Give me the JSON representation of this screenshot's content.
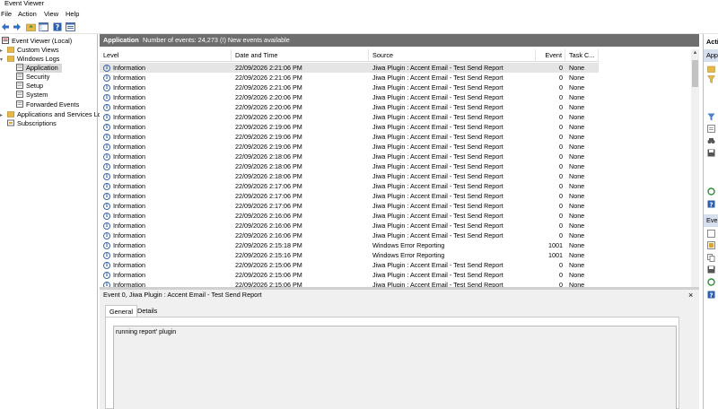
{
  "window": {
    "title": "Event Viewer"
  },
  "menu": [
    "File",
    "Action",
    "View",
    "Help"
  ],
  "tree": {
    "root": "Event Viewer (Local)",
    "custom_views": "Custom Views",
    "windows_logs": "Windows Logs",
    "logs": [
      "Application",
      "Security",
      "Setup",
      "System",
      "Forwarded Events"
    ],
    "apps_services": "Applications and Services Lo",
    "subscriptions": "Subscriptions"
  },
  "header": {
    "log_name": "Application",
    "count_text": "Number of events: 24,273 (!) New events available"
  },
  "columns": [
    "Level",
    "Date and Time",
    "Source",
    "Event ID",
    "Task C..."
  ],
  "rows": [
    {
      "level": "Information",
      "date": "22/09/2026 2:21:06 PM",
      "source": "Jiwa Plugin : Accent Email - Test Send Report",
      "id": "0",
      "task": "None"
    },
    {
      "level": "Information",
      "date": "22/09/2026 2:21:06 PM",
      "source": "Jiwa Plugin : Accent Email - Test Send Report",
      "id": "0",
      "task": "None"
    },
    {
      "level": "Information",
      "date": "22/09/2026 2:21:06 PM",
      "source": "Jiwa Plugin : Accent Email - Test Send Report",
      "id": "0",
      "task": "None"
    },
    {
      "level": "Information",
      "date": "22/09/2026 2:20:06 PM",
      "source": "Jiwa Plugin : Accent Email - Test Send Report",
      "id": "0",
      "task": "None"
    },
    {
      "level": "Information",
      "date": "22/09/2026 2:20:06 PM",
      "source": "Jiwa Plugin : Accent Email - Test Send Report",
      "id": "0",
      "task": "None"
    },
    {
      "level": "Information",
      "date": "22/09/2026 2:20:06 PM",
      "source": "Jiwa Plugin : Accent Email - Test Send Report",
      "id": "0",
      "task": "None"
    },
    {
      "level": "Information",
      "date": "22/09/2026 2:19:06 PM",
      "source": "Jiwa Plugin : Accent Email - Test Send Report",
      "id": "0",
      "task": "None"
    },
    {
      "level": "Information",
      "date": "22/09/2026 2:19:06 PM",
      "source": "Jiwa Plugin : Accent Email - Test Send Report",
      "id": "0",
      "task": "None"
    },
    {
      "level": "Information",
      "date": "22/09/2026 2:19:06 PM",
      "source": "Jiwa Plugin : Accent Email - Test Send Report",
      "id": "0",
      "task": "None"
    },
    {
      "level": "Information",
      "date": "22/09/2026 2:18:06 PM",
      "source": "Jiwa Plugin : Accent Email - Test Send Report",
      "id": "0",
      "task": "None"
    },
    {
      "level": "Information",
      "date": "22/09/2026 2:18:06 PM",
      "source": "Jiwa Plugin : Accent Email - Test Send Report",
      "id": "0",
      "task": "None"
    },
    {
      "level": "Information",
      "date": "22/09/2026 2:18:06 PM",
      "source": "Jiwa Plugin : Accent Email - Test Send Report",
      "id": "0",
      "task": "None"
    },
    {
      "level": "Information",
      "date": "22/09/2026 2:17:06 PM",
      "source": "Jiwa Plugin : Accent Email - Test Send Report",
      "id": "0",
      "task": "None"
    },
    {
      "level": "Information",
      "date": "22/09/2026 2:17:06 PM",
      "source": "Jiwa Plugin : Accent Email - Test Send Report",
      "id": "0",
      "task": "None"
    },
    {
      "level": "Information",
      "date": "22/09/2026 2:17:06 PM",
      "source": "Jiwa Plugin : Accent Email - Test Send Report",
      "id": "0",
      "task": "None"
    },
    {
      "level": "Information",
      "date": "22/09/2026 2:16:06 PM",
      "source": "Jiwa Plugin : Accent Email - Test Send Report",
      "id": "0",
      "task": "None"
    },
    {
      "level": "Information",
      "date": "22/09/2026 2:16:06 PM",
      "source": "Jiwa Plugin : Accent Email - Test Send Report",
      "id": "0",
      "task": "None"
    },
    {
      "level": "Information",
      "date": "22/09/2026 2:16:06 PM",
      "source": "Jiwa Plugin : Accent Email - Test Send Report",
      "id": "0",
      "task": "None"
    },
    {
      "level": "Information",
      "date": "22/09/2026 2:15:18 PM",
      "source": "Windows Error Reporting",
      "id": "1001",
      "task": "None"
    },
    {
      "level": "Information",
      "date": "22/09/2026 2:15:16 PM",
      "source": "Windows Error Reporting",
      "id": "1001",
      "task": "None"
    },
    {
      "level": "Information",
      "date": "22/09/2026 2:15:06 PM",
      "source": "Jiwa Plugin : Accent Email - Test Send Report",
      "id": "0",
      "task": "None"
    },
    {
      "level": "Information",
      "date": "22/09/2026 2:15:06 PM",
      "source": "Jiwa Plugin : Accent Email - Test Send Report",
      "id": "0",
      "task": "None"
    },
    {
      "level": "Information",
      "date": "22/09/2026 2:15:06 PM",
      "source": "Jiwa Plugin : Accent Email - Test Send Report",
      "id": "0",
      "task": "None"
    }
  ],
  "detail": {
    "title": "Event 0, Jiwa Plugin : Accent Email - Test Send Report",
    "close": "×",
    "tabs": [
      "General",
      "Details"
    ],
    "description": "running report' plugin"
  },
  "actions": {
    "header": "Acti",
    "section1": "App",
    "section2": "Eve"
  }
}
